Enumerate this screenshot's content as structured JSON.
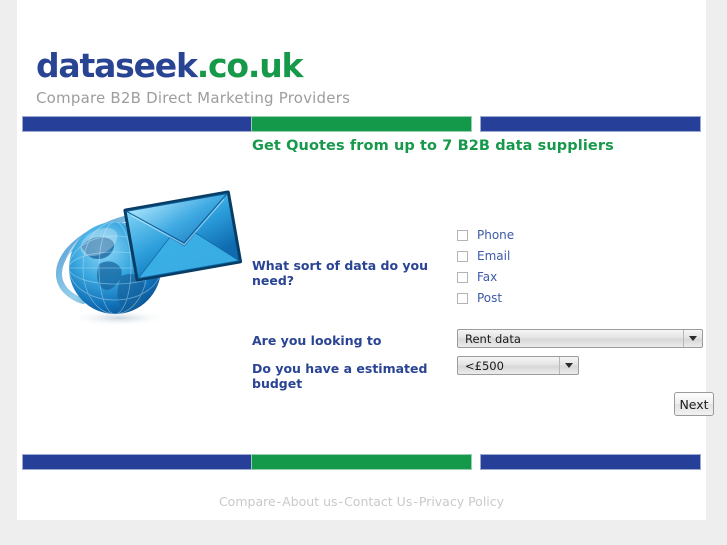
{
  "site": {
    "logo_primary": "dataseek",
    "logo_suffix": ".co.uk",
    "tagline": "Compare B2B Direct Marketing Providers",
    "colors": {
      "blue": "#26409a",
      "green": "#14994a",
      "logo_blue": "#2a4494",
      "logo_green": "#17994a",
      "label_blue": "#2a4494",
      "checkbox_label_blue": "#3d5aa8",
      "tagline_grey": "#9d9d9d",
      "footer_grey": "#c9c9c9",
      "page_background": "#eeeeee",
      "content_background": "#ffffff"
    }
  },
  "headline": "Get Quotes from up to 7 B2B data suppliers",
  "hero": {
    "alt": "globe-and-envelope-illustration"
  },
  "form": {
    "data_type": {
      "label": "What sort of data do you need?",
      "options": [
        {
          "label": "Phone",
          "checked": false
        },
        {
          "label": "Email",
          "checked": false
        },
        {
          "label": "Fax",
          "checked": false
        },
        {
          "label": "Post",
          "checked": false
        }
      ]
    },
    "looking_to": {
      "label": "Are you looking to",
      "value": "Rent data"
    },
    "budget": {
      "label": "Do you have a estimated budget",
      "value": "<£500"
    },
    "next_label": "Next"
  },
  "footer": {
    "links": [
      "Compare",
      "About us",
      "Contact Us",
      "Privacy Policy"
    ],
    "separator": "-"
  }
}
